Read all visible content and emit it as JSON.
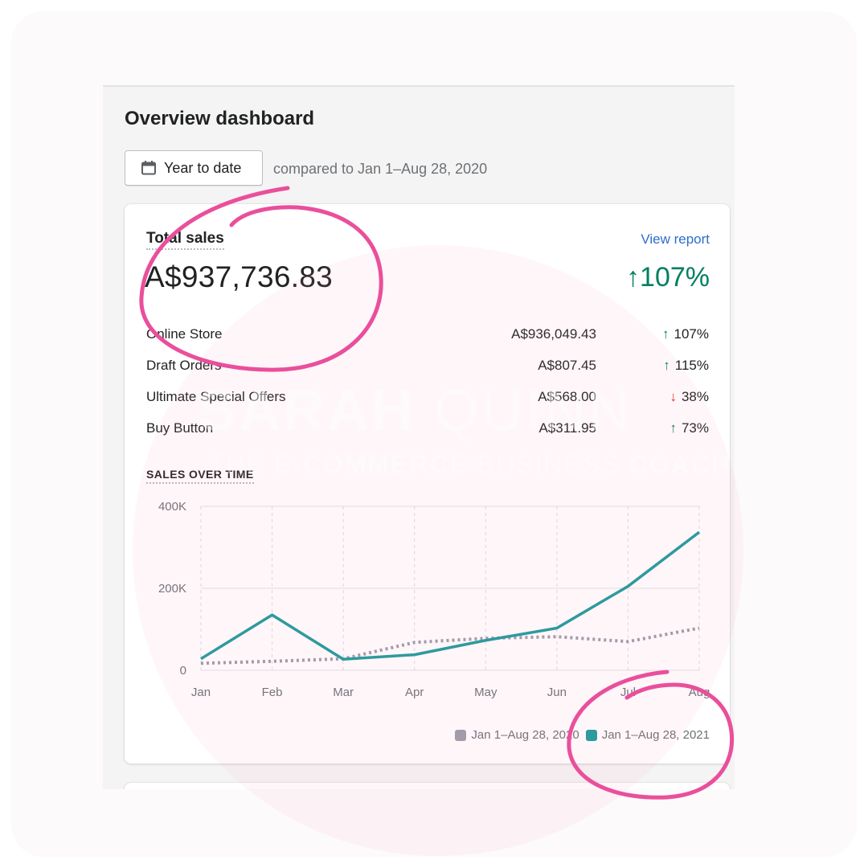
{
  "page": {
    "title": "Overview dashboard"
  },
  "date_picker": {
    "label": "Year to date",
    "icon": "calendar-icon"
  },
  "comparison": {
    "text": "compared to Jan 1–Aug 28, 2020"
  },
  "total_sales": {
    "label": "Total sales",
    "view_report": "View report",
    "value": "A$937,736.83",
    "change": "107%",
    "change_direction": "up"
  },
  "breakdown": [
    {
      "name": "Online Store",
      "amount": "A$936,049.43",
      "change": "107%",
      "direction": "up"
    },
    {
      "name": "Draft Orders",
      "amount": "A$807.45",
      "change": "115%",
      "direction": "up"
    },
    {
      "name": "Ultimate Special Offers",
      "amount": "A$568.00",
      "change": "38%",
      "direction": "down"
    },
    {
      "name": "Buy Button",
      "amount": "A$311.95",
      "change": "73%",
      "direction": "up"
    }
  ],
  "sales_over_time": {
    "title": "SALES OVER TIME"
  },
  "colors": {
    "current": "#1a9a9c",
    "previous": "#9a9ba8",
    "up": "#007f5f",
    "down": "#d72c0d",
    "link": "#2c6ecb",
    "annotation": "#ea4f9b"
  },
  "chart_data": {
    "type": "line",
    "categories": [
      "Jan",
      "Feb",
      "Mar",
      "Apr",
      "May",
      "Jun",
      "Jul",
      "Aug"
    ],
    "ylim": [
      0,
      400000
    ],
    "y_ticks": [
      {
        "value": 0,
        "label": "0"
      },
      {
        "value": 200000,
        "label": "200K"
      },
      {
        "value": 400000,
        "label": "400K"
      }
    ],
    "grid": true,
    "legend_position": "bottom-right",
    "series": [
      {
        "name": "Jan 1–Aug 28, 2020",
        "style": "dotted",
        "color": "#9a9ba8",
        "values": [
          17000,
          22000,
          28000,
          68000,
          78000,
          82000,
          70000,
          103000
        ]
      },
      {
        "name": "Jan 1–Aug 28, 2021",
        "style": "solid",
        "color": "#1a9a9c",
        "values": [
          28000,
          135000,
          27000,
          38000,
          73000,
          103000,
          205000,
          337000
        ]
      }
    ]
  },
  "watermark": {
    "name_bold": "SARAH",
    "name_light": "QUINN",
    "tagline_light": "THE",
    "tagline_bold": "E-COMMERCE",
    "tagline_light2": "BUSINESS",
    "tagline_bold2": "COACH"
  }
}
